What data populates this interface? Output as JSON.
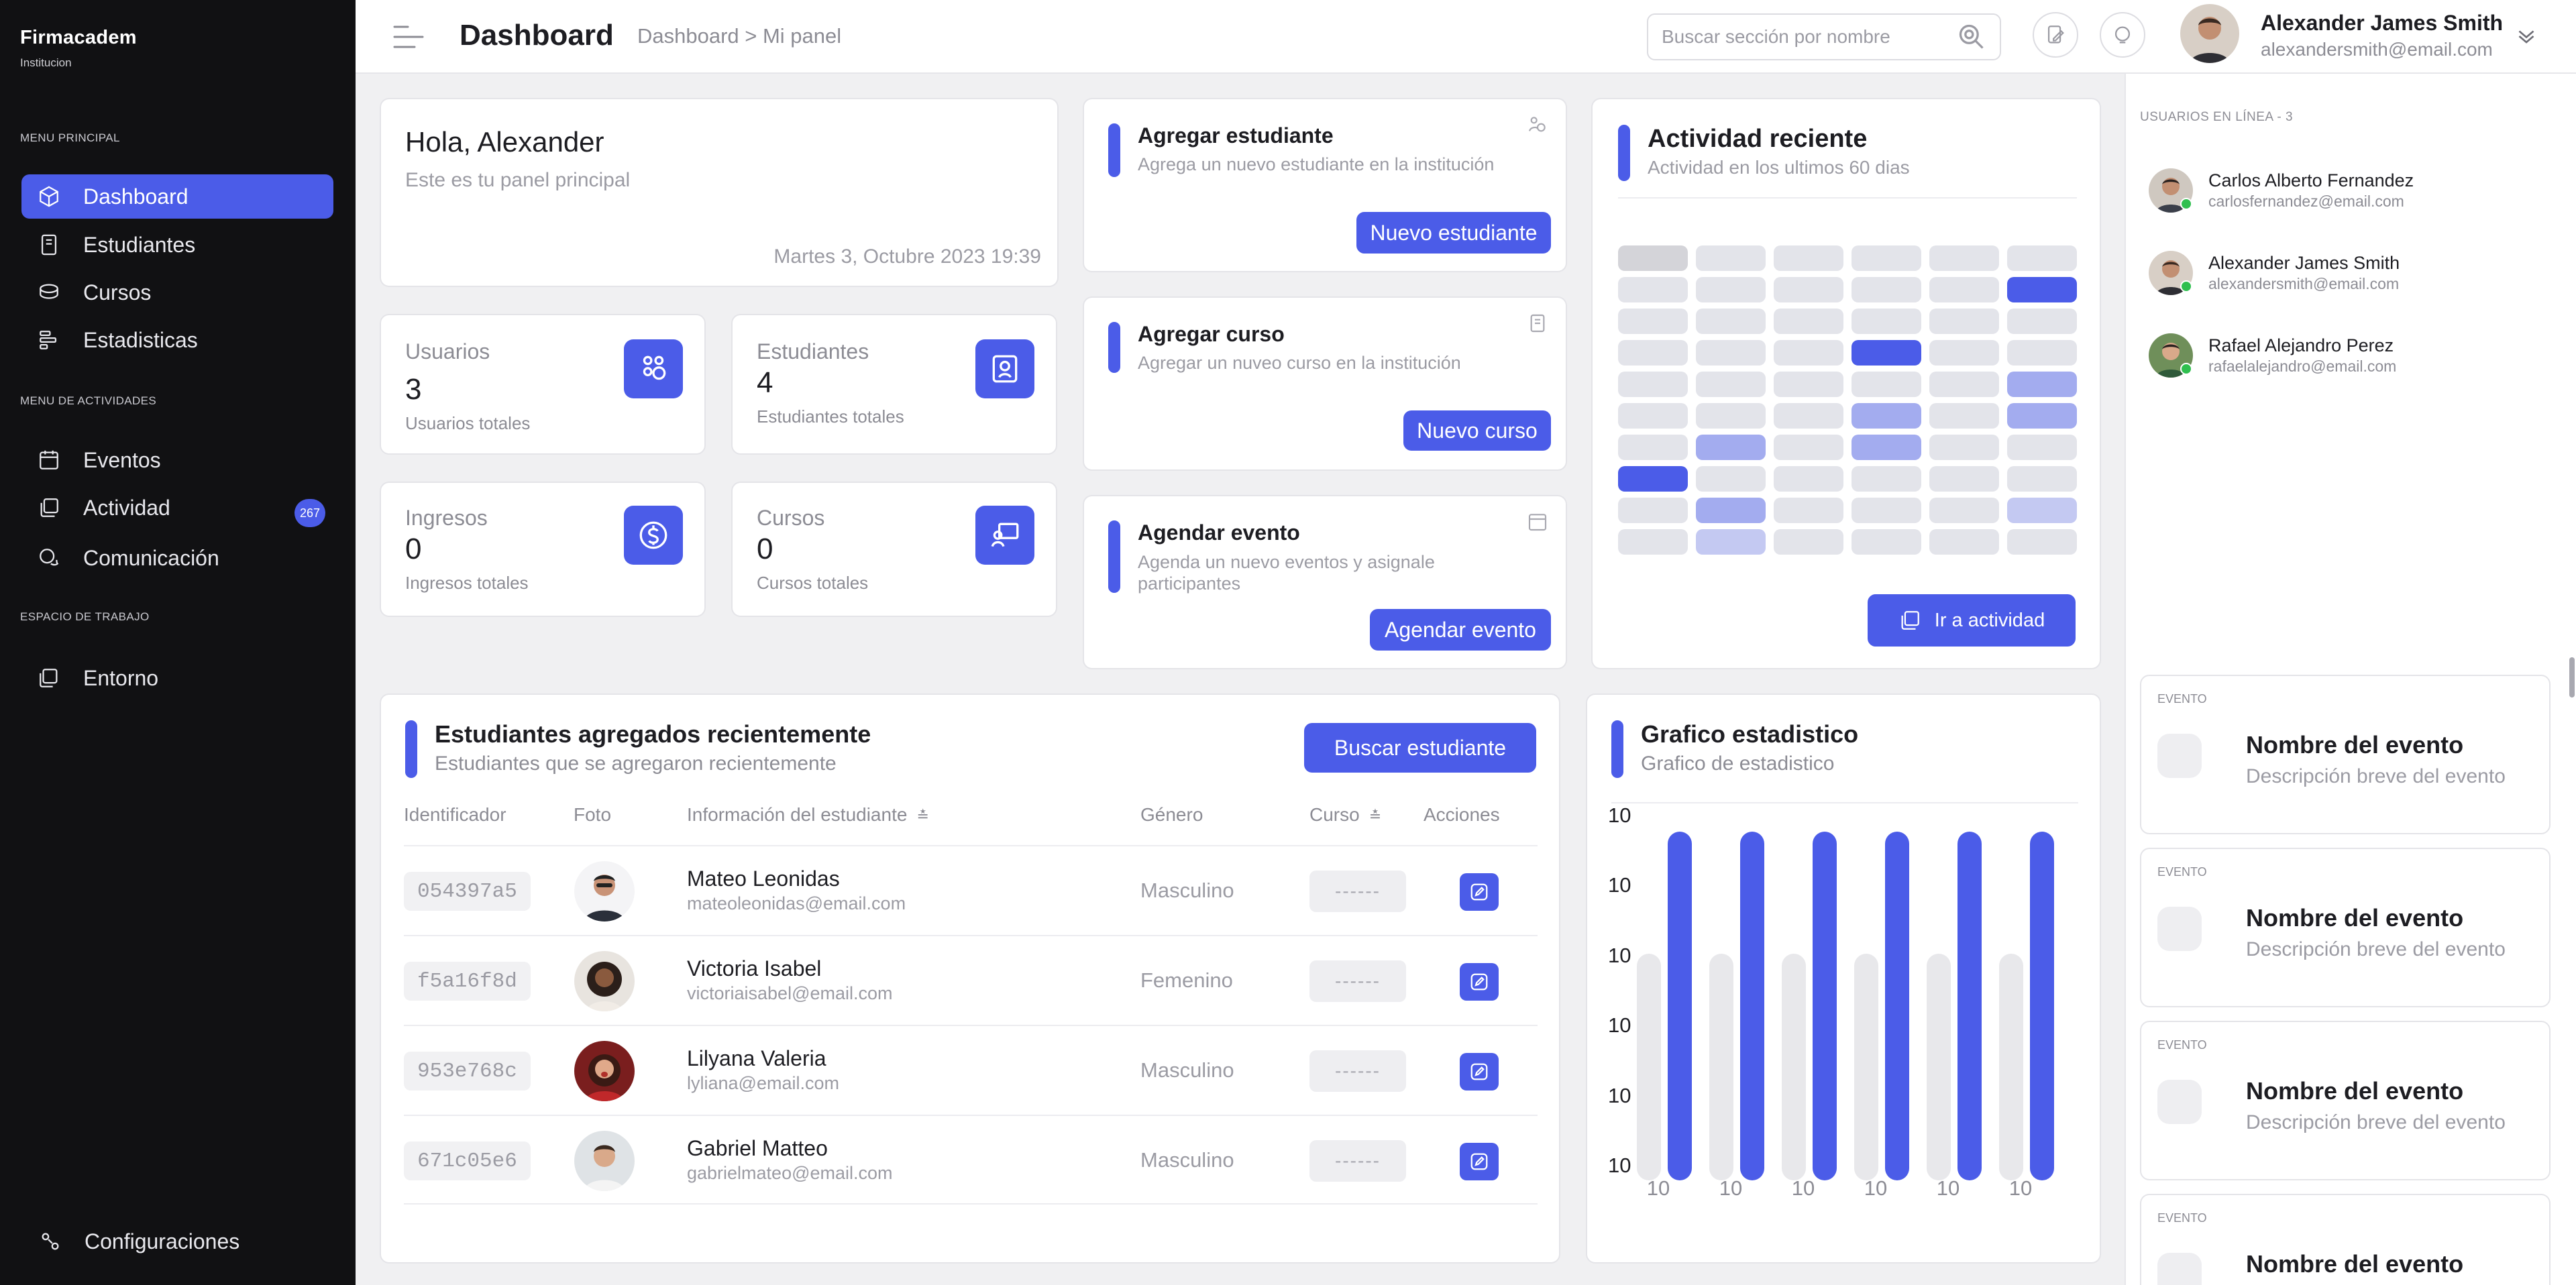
{
  "sidebar": {
    "brand": "Firmacadem",
    "brand_sub": "Institucion",
    "sections": {
      "main": "MENU PRINCIPAL",
      "activities": "MENU DE ACTIVIDADES",
      "workspace": "ESPACIO DE TRABAJO"
    },
    "items": {
      "dashboard": "Dashboard",
      "students": "Estudiantes",
      "courses": "Cursos",
      "stats": "Estadisticas",
      "events": "Eventos",
      "activity": "Actividad",
      "activity_count": "267",
      "communication": "Comunicación",
      "environment": "Entorno",
      "settings": "Configuraciones"
    }
  },
  "header": {
    "title": "Dashboard",
    "breadcrumb": "Dashboard > Mi panel",
    "search_placeholder": "Buscar sección por nombre",
    "user_name": "Alexander James Smith",
    "user_email": "alexandersmith@email.com"
  },
  "welcome": {
    "greeting": "Hola, Alexander",
    "subtitle": "Este es tu panel principal",
    "date": "Martes 3, Octubre 2023 19:39"
  },
  "stats": {
    "users": {
      "label": "Usuarios",
      "value": "3",
      "desc": "Usuarios totales"
    },
    "students": {
      "label": "Estudiantes",
      "value": "4",
      "desc": "Estudiantes totales"
    },
    "income": {
      "label": "Ingresos",
      "value": "0",
      "desc": "Ingresos totales"
    },
    "courses": {
      "label": "Cursos",
      "value": "0",
      "desc": "Cursos totales"
    }
  },
  "quick_actions": {
    "add_student": {
      "title": "Agregar estudiante",
      "desc": "Agrega un nuevo estudiante en la institución",
      "button": "Nuevo estudiante"
    },
    "add_course": {
      "title": "Agregar curso",
      "desc": "Agregar un nuveo curso en la institución",
      "button": "Nuevo curso"
    },
    "schedule_event": {
      "title": "Agendar evento",
      "desc": "Agenda un nuevo eventos y asignale participantes",
      "button": "Agendar evento"
    }
  },
  "activity": {
    "title": "Actividad reciente",
    "subtitle": "Actividad en los ultimos 60 dias",
    "button": "Ir a actividad",
    "levels": [
      [
        1,
        0,
        0,
        0,
        0,
        0
      ],
      [
        0,
        0,
        0,
        0,
        0,
        4
      ],
      [
        0,
        0,
        0,
        0,
        0,
        0
      ],
      [
        0,
        0,
        0,
        4,
        0,
        0
      ],
      [
        0,
        0,
        0,
        0,
        0,
        3
      ],
      [
        0,
        0,
        0,
        3,
        0,
        3
      ],
      [
        0,
        3,
        0,
        3,
        0,
        0
      ],
      [
        4,
        0,
        0,
        0,
        0,
        0
      ],
      [
        0,
        3,
        0,
        0,
        0,
        2
      ],
      [
        0,
        2,
        0,
        0,
        0,
        0
      ]
    ]
  },
  "recent_students": {
    "title": "Estudiantes agregados recientemente",
    "subtitle": "Estudiantes que se agregaron recientemente",
    "button": "Buscar estudiante",
    "columns": {
      "id": "Identificador",
      "photo": "Foto",
      "info": "Información del estudiante",
      "gender": "Género",
      "course": "Curso",
      "actions": "Acciones"
    },
    "rows": [
      {
        "id": "054397a5",
        "name": "Mateo Leonidas",
        "email": "mateoleonidas@email.com",
        "gender": "Masculino",
        "course": "------"
      },
      {
        "id": "f5a16f8d",
        "name": "Victoria Isabel",
        "email": "victoriaisabel@email.com",
        "gender": "Femenino",
        "course": "------"
      },
      {
        "id": "953e768c",
        "name": "Lilyana Valeria",
        "email": "lyliana@email.com",
        "gender": "Masculino",
        "course": "------"
      },
      {
        "id": "671c05e6",
        "name": "Gabriel Matteo",
        "email": "gabrielmateo@email.com",
        "gender": "Masculino",
        "course": "------"
      }
    ]
  },
  "chart_data": {
    "type": "bar",
    "title": "Grafico estadistico",
    "subtitle": "Grafico de estadistico",
    "categories": [
      "10",
      "10",
      "10",
      "10",
      "10",
      "10"
    ],
    "y_ticks": [
      "10",
      "10",
      "10",
      "10",
      "10",
      "10"
    ],
    "series": [
      {
        "values": [
          65,
          65,
          65,
          65,
          65,
          65
        ],
        "color": "#e8e8eb"
      },
      {
        "values": [
          100,
          100,
          100,
          100,
          100,
          100
        ],
        "color": "#4b5ce8"
      }
    ]
  },
  "online": {
    "label": "USUARIOS EN LÍNEA - 3",
    "users": [
      {
        "name": "Carlos Alberto Fernandez",
        "email": "carlosfernandez@email.com"
      },
      {
        "name": "Alexander James Smith",
        "email": "alexandersmith@email.com"
      },
      {
        "name": "Rafael Alejandro Perez",
        "email": "rafaelalejandro@email.com"
      }
    ]
  },
  "events": [
    {
      "label": "EVENTO",
      "title": "Nombre del evento",
      "desc": "Descripción breve del evento"
    },
    {
      "label": "EVENTO",
      "title": "Nombre del evento",
      "desc": "Descripción breve del evento"
    },
    {
      "label": "EVENTO",
      "title": "Nombre del evento",
      "desc": "Descripción breve del evento"
    },
    {
      "label": "EVENTO",
      "title": "Nombre del evento"
    }
  ],
  "colors": {
    "accent": "#4b5ce8",
    "sidebar": "#111113",
    "online": "#2fbf4f"
  }
}
